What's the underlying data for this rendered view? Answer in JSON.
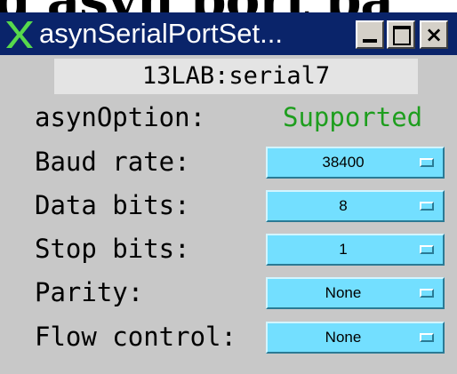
{
  "background": {
    "heading_fragment": "g asyn port pa"
  },
  "window": {
    "title": "asynSerialPortSet...",
    "app_icon": "x-logo-icon",
    "buttons": {
      "minimize": "minimize-icon",
      "maximize": "maximize-icon",
      "close": "×"
    }
  },
  "device": {
    "name": "13LAB:serial7"
  },
  "option": {
    "label": "asynOption:",
    "value": "Supported",
    "value_color": "#1e9e1e"
  },
  "settings": [
    {
      "label": "Baud rate:",
      "value": "38400"
    },
    {
      "label": "Data bits:",
      "value": "8"
    },
    {
      "label": "Stop bits:",
      "value": "1"
    },
    {
      "label": "Parity:",
      "value": "None"
    },
    {
      "label": "Flow control:",
      "value": "None"
    }
  ],
  "colors": {
    "titlebar": "#0a246a",
    "panel": "#c8c8c8",
    "menu_button": "#73dfff"
  }
}
